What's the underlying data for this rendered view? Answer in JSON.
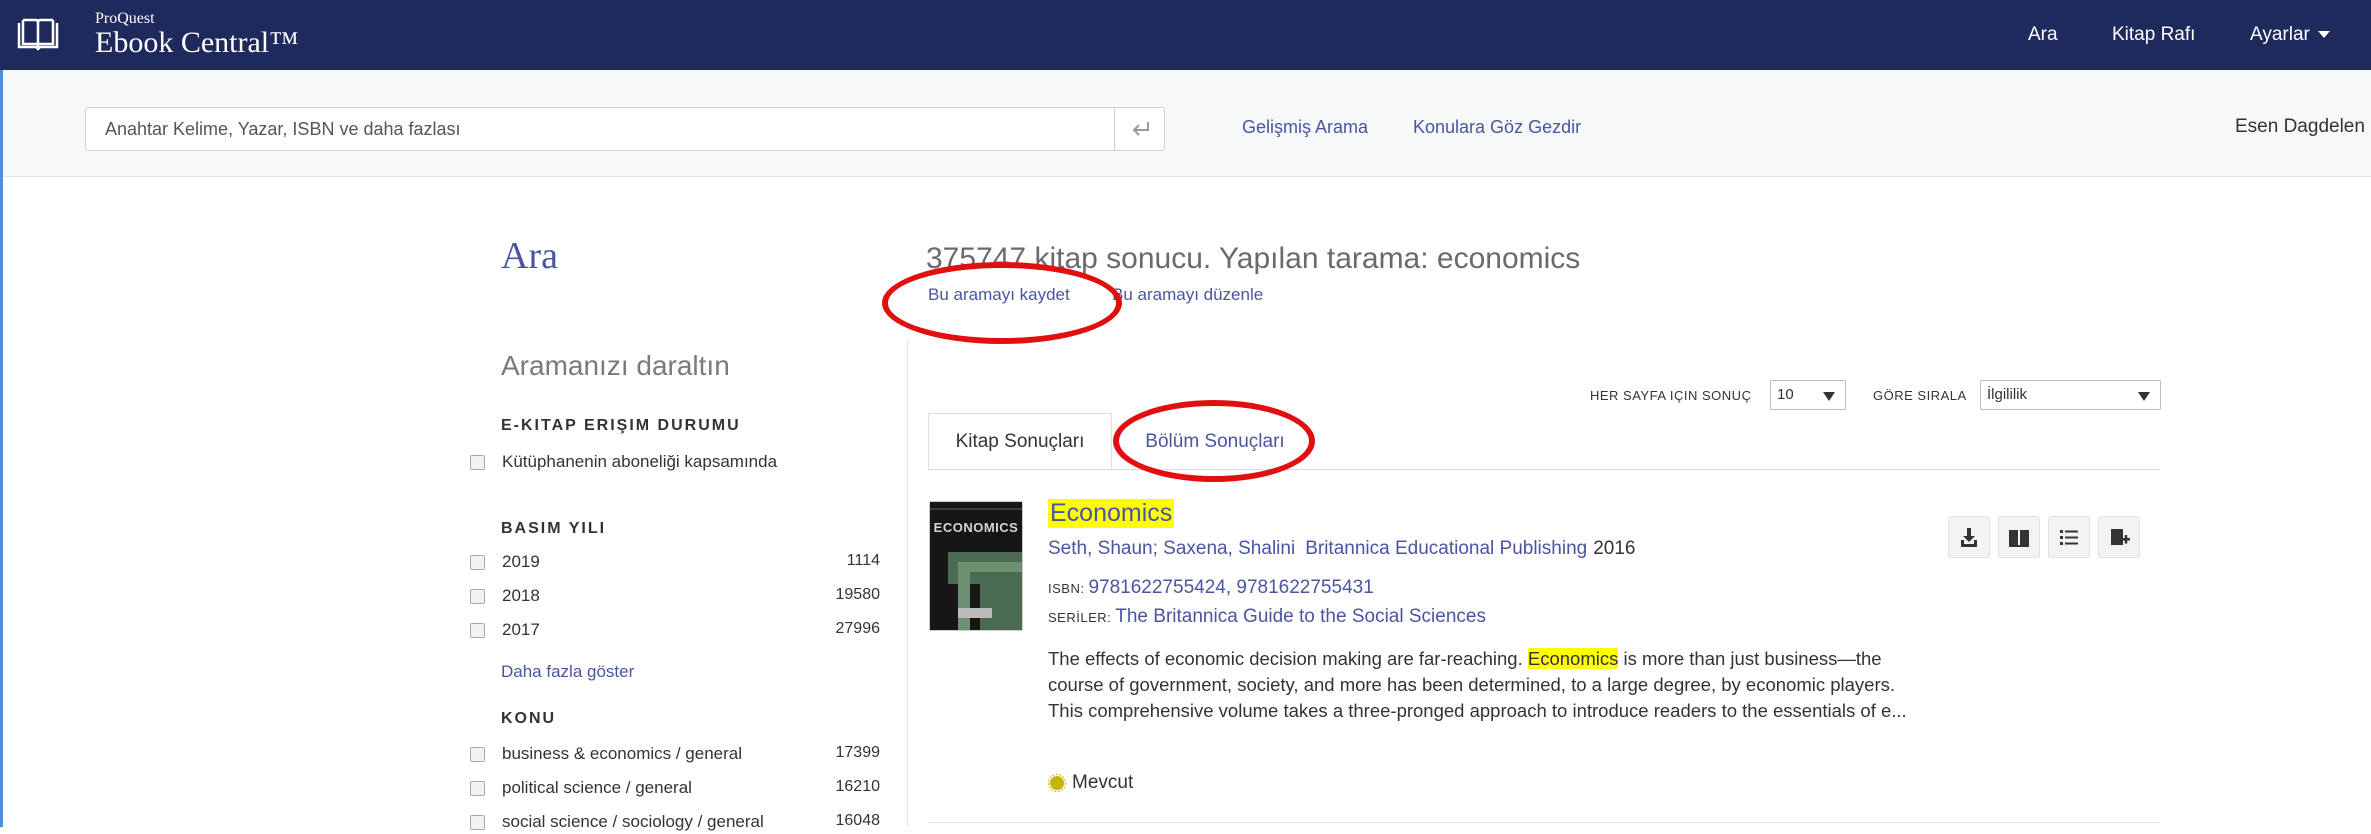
{
  "header": {
    "brand_small": "ProQuest",
    "brand_big": "Ebook Central™",
    "nav": {
      "search": "Ara",
      "bookshelf": "Kitap Rafı",
      "settings": "Ayarlar"
    }
  },
  "searchbar": {
    "placeholder": "Anahtar Kelime, Yazar, ISBN ve daha fazlası",
    "advanced_search": "Gelişmiş Arama",
    "browse_subjects": "Konulara Göz Gezdir",
    "user_name": "Esen Dagdelen"
  },
  "page": {
    "title": "Ara",
    "result_headline": "375747 kitap sonucu. Yapılan tarama: economics",
    "save_search": "Bu aramayı kaydet",
    "edit_search": "Bu aramayı düzenle"
  },
  "sidebar": {
    "narrow_title": "Aramanızı daraltın",
    "access": {
      "heading": "E-KITAP ERIŞIM DURUMU",
      "items": [
        {
          "label": "Kütüphanenin aboneliği kapsamında",
          "count": ""
        }
      ]
    },
    "year": {
      "heading": "BASIM YILI",
      "items": [
        {
          "label": "2019",
          "count": "1114"
        },
        {
          "label": "2018",
          "count": "19580"
        },
        {
          "label": "2017",
          "count": "27996"
        }
      ],
      "show_more": "Daha fazla göster"
    },
    "subject": {
      "heading": "KONU",
      "items": [
        {
          "label": "business & economics / general",
          "count": "17399"
        },
        {
          "label": "political science / general",
          "count": "16210"
        },
        {
          "label": "social science / sociology / general",
          "count": "16048"
        }
      ]
    }
  },
  "controls": {
    "per_page_label": "HER SAYFA IÇIN SONUÇ",
    "per_page_value": "10",
    "sort_label": "GÖRE SIRALA",
    "sort_value": "İlgililik"
  },
  "tabs": {
    "book_results": "Kitap Sonuçları",
    "chapter_results": "Bölüm Sonuçları"
  },
  "result": {
    "cover_text": "ECONOMICS",
    "title": "Economics",
    "authors": "Seth, Shaun; Saxena, Shalini",
    "publisher": "Britannica Educational Publishing",
    "year": "2016",
    "isbn_label": "ISBN:",
    "isbn": "9781622755424, 9781622755431",
    "series_label": "SERİLER:",
    "series": "The Britannica Guide to the Social Sciences",
    "description_before": "The effects of economic decision making are far-reaching. ",
    "description_highlight": "Economics",
    "description_after": " is more than just business—the course of government, society, and more has been determined, to a large degree, by economic players. This comprehensive volume takes a three-pronged approach to introduce readers to the essentials of e...",
    "availability": "Mevcut"
  },
  "icons": {
    "logo": "open-book-icon",
    "enter": "enter-key-icon",
    "download": "download-icon",
    "read": "read-book-icon",
    "toc": "list-icon",
    "add": "add-to-shelf-icon"
  },
  "colors": {
    "header_bg": "#1f2a5c",
    "link": "#4a55a2",
    "highlight": "#ffff00",
    "annotation": "#e01010",
    "available": "#c8b400"
  }
}
